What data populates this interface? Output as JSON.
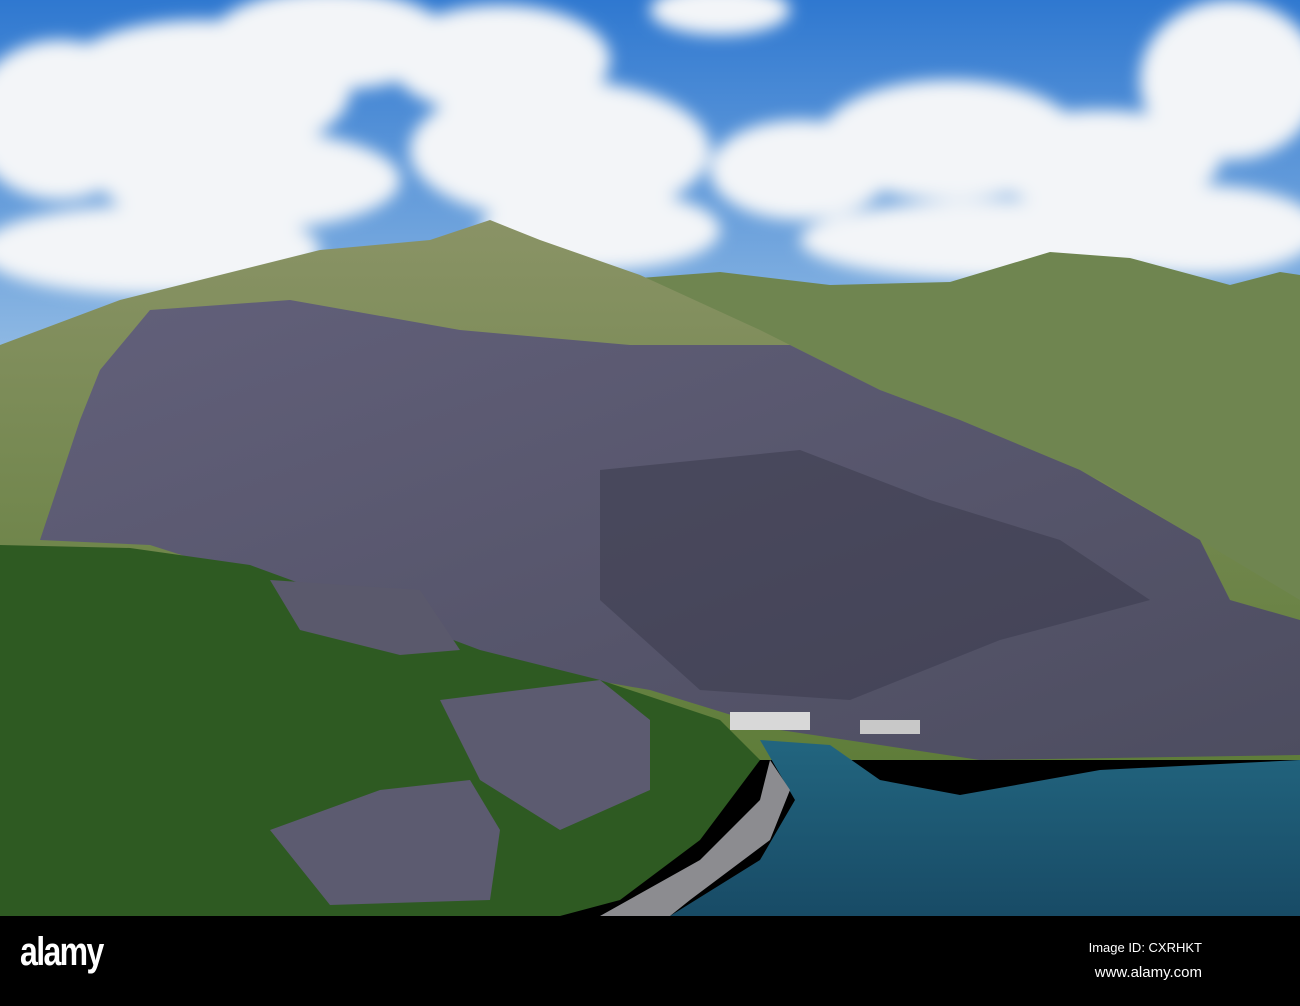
{
  "photo": {
    "subject": "aerial view of slate quarry on mountainside above lake",
    "colors": {
      "sky": "#3d86d6",
      "cloud": "#f4f6f8",
      "grass": "#7d8c55",
      "slate": "#5b5a6e",
      "forest": "#2e5a22",
      "lake": "#1d5a78"
    }
  },
  "watermark": {
    "logo": "alamy",
    "image_id": "Image ID: CXRHKT",
    "url": "www.alamy.com"
  }
}
